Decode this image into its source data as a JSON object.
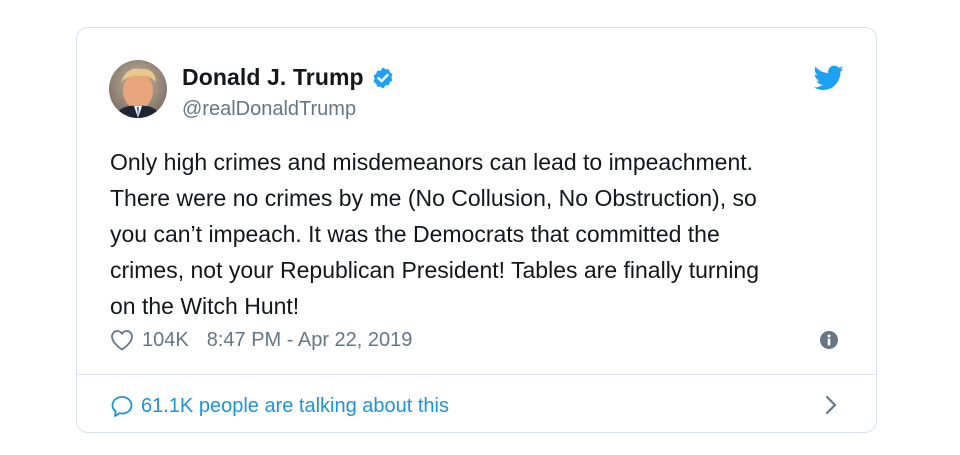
{
  "author": {
    "display_name": "Donald J. Trump",
    "handle": "@realDonaldTrump",
    "verified": true
  },
  "tweet": {
    "text_lines": [
      "Only high crimes and misdemeanors can lead to impeachment.",
      "There were no crimes by me (No Collusion, No Obstruction), so",
      "you can’t impeach. It was the Democrats that committed the",
      "crimes, not your Republican President! Tables are finally turning",
      "on the Witch Hunt!"
    ]
  },
  "meta": {
    "likes": "104K",
    "timestamp": "8:47 PM - Apr 22, 2019"
  },
  "conversation": {
    "label": "61.1K people are talking about this"
  },
  "icons": {
    "brand": "twitter-bird-icon",
    "verified": "verified-badge-icon",
    "like": "heart-icon",
    "info": "info-icon",
    "reply": "speech-bubble-icon",
    "more": "chevron-right-icon"
  },
  "colors": {
    "twitter_blue": "#1da1f2",
    "link_blue": "#1b95e0",
    "text": "#14171a",
    "muted": "#657786",
    "border": "#d9e1e8"
  }
}
